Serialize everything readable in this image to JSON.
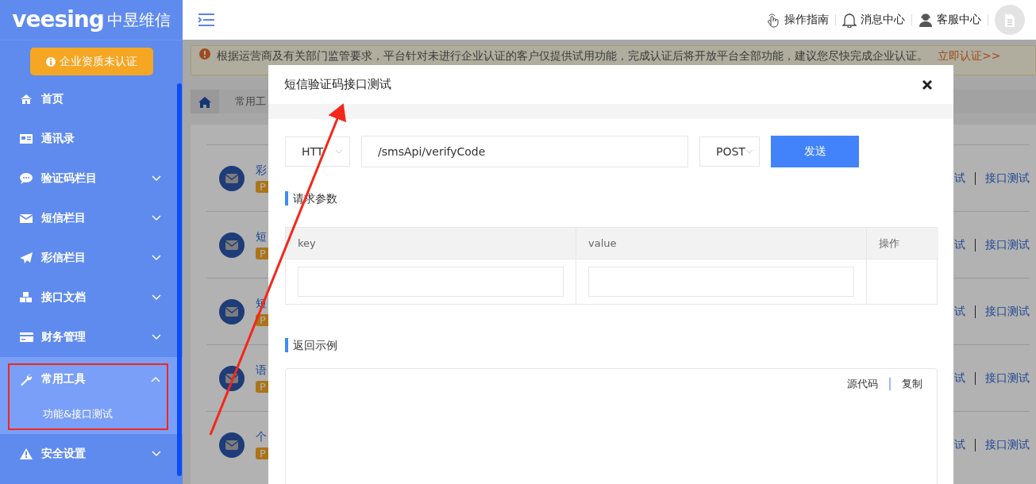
{
  "sidebar": {
    "logo": {
      "brand": "veesing",
      "name": "中昱维信"
    },
    "notice_button": "企业资质未认证",
    "menu": [
      {
        "label": "首页",
        "expandable": false
      },
      {
        "label": "通讯录",
        "expandable": false
      },
      {
        "label": "验证码栏目",
        "expandable": true,
        "expanded": false
      },
      {
        "label": "短信栏目",
        "expandable": true,
        "expanded": false
      },
      {
        "label": "彩信栏目",
        "expandable": true,
        "expanded": false
      },
      {
        "label": "接口文档",
        "expandable": true,
        "expanded": false
      },
      {
        "label": "财务管理",
        "expandable": true,
        "expanded": false
      },
      {
        "label": "常用工具",
        "expandable": true,
        "expanded": true,
        "annotated": true,
        "children": [
          {
            "label": "功能&接口测试"
          }
        ]
      },
      {
        "label": "安全设置",
        "expandable": true,
        "expanded": false
      }
    ]
  },
  "header": {
    "links": [
      {
        "label": "操作指南"
      },
      {
        "label": "消息中心"
      },
      {
        "label": "客服中心"
      }
    ]
  },
  "banner": {
    "text": "根据运营商及有关部门监管要求，平台针对未进行企业认证的客户仅提供试用功能，完成认证后将开放平台全部功能，建议您尽快完成企业认证。",
    "link": "立即认证>>"
  },
  "breadcrumb": {
    "current": "常用工"
  },
  "tools": [
    {
      "title": "彩",
      "badge": "P",
      "action_1": "试",
      "action_2": "接口测试"
    },
    {
      "title": "短",
      "badge": "P",
      "action_1": "试",
      "action_2": "接口测试"
    },
    {
      "title": "短",
      "badge": "P",
      "action_1": "试",
      "action_2": "接口测试"
    },
    {
      "title": "语",
      "badge": "P",
      "action_1": "试",
      "action_2": "接口测试"
    },
    {
      "title": "个",
      "badge": "P",
      "action_1": "试",
      "action_2": "接口测试"
    }
  ],
  "modal": {
    "title": "短信验证码接口测试",
    "protocol": "HTT",
    "url": "/smsApi/verifyCode",
    "method": "POST",
    "send_button": "发送",
    "params_heading": "请求参数",
    "params_table": {
      "columns": [
        "key",
        "value",
        "操作"
      ],
      "rows": [
        {
          "kind": "editable"
        }
      ]
    },
    "response_heading": "返回示例",
    "response_actions": [
      "源代码",
      "复制"
    ]
  },
  "annotation": {
    "kind": "arrow"
  }
}
